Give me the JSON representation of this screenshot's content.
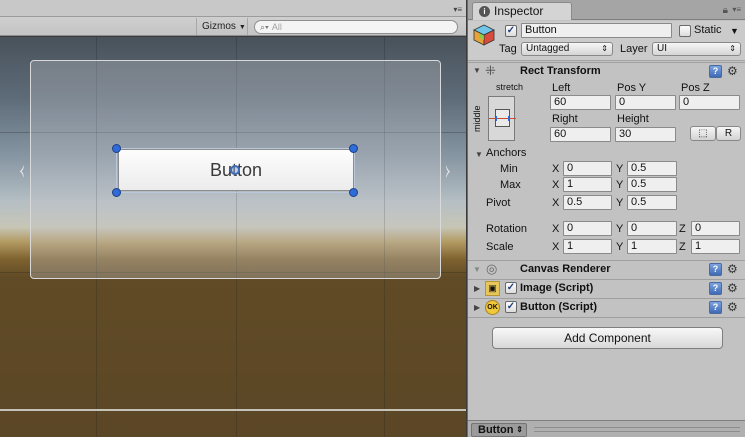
{
  "scene": {
    "gizmos_label": "Gizmos",
    "search_placeholder": "All",
    "button_text": "Button"
  },
  "inspector": {
    "tab_label": "Inspector",
    "object_name": "Button",
    "static_label": "Static",
    "tag_label": "Tag",
    "tag_value": "Untagged",
    "layer_label": "Layer",
    "layer_value": "UI",
    "preview_label": "Button"
  },
  "rect_transform": {
    "title": "Rect Transform",
    "stretch_label": "stretch",
    "middle_label": "middle",
    "left_label": "Left",
    "left_value": "60",
    "posy_label": "Pos Y",
    "posy_value": "0",
    "posz_label": "Pos Z",
    "posz_value": "0",
    "right_label": "Right",
    "right_value": "60",
    "height_label": "Height",
    "height_value": "30",
    "raw_button": "R",
    "anchors_label": "Anchors",
    "min_label": "Min",
    "min_x": "0",
    "min_y": "0.5",
    "max_label": "Max",
    "max_x": "1",
    "max_y": "0.5",
    "pivot_label": "Pivot",
    "pivot_x": "0.5",
    "pivot_y": "0.5",
    "rotation_label": "Rotation",
    "rot_x": "0",
    "rot_y": "0",
    "rot_z": "0",
    "scale_label": "Scale",
    "scale_x": "1",
    "scale_y": "1",
    "scale_z": "1",
    "x_label": "X",
    "y_label": "Y",
    "z_label": "Z"
  },
  "components": {
    "canvas_renderer": "Canvas Renderer",
    "image_script": "Image (Script)",
    "button_script": "Button (Script)",
    "add_component": "Add Component"
  },
  "colors": {
    "accent_handle": "#2f6bd9",
    "inspector_bg": "#c2c2c2"
  }
}
